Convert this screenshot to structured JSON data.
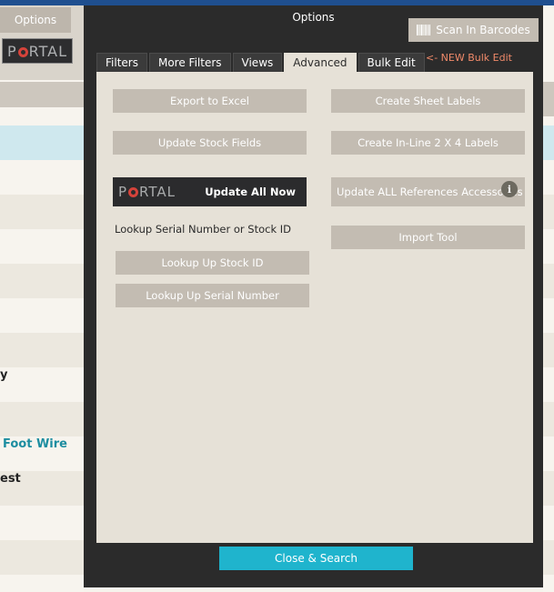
{
  "background": {
    "options_button": "Options",
    "portal_logo": {
      "before": "P",
      "after": "RTAL"
    },
    "row_snippets": [
      "y",
      "Foot Wire",
      "est"
    ]
  },
  "modal": {
    "title": "Options",
    "scan_button": "Scan In Barcodes",
    "tabs": [
      {
        "label": "Filters"
      },
      {
        "label": "More Filters"
      },
      {
        "label": "Views"
      },
      {
        "label": "Advanced",
        "active": true
      },
      {
        "label": "Bulk Edit"
      }
    ],
    "new_notice": "<- NEW Bulk Edit",
    "buttons": {
      "export_excel": "Export to Excel",
      "create_sheet_labels": "Create Sheet Labels",
      "update_stock_fields": "Update Stock Fields",
      "create_inline_labels": "Create In-Line 2 X 4 Labels",
      "update_all_now": "Update All Now",
      "update_all_references": "Update ALL References Accessories",
      "import_tool": "Import Tool",
      "lookup_stock_id": "Lookup Up Stock ID",
      "lookup_serial": "Lookup Up Serial Number"
    },
    "portal_logo": {
      "before": "P",
      "after": "RTAL"
    },
    "lookup_label": "Lookup Serial Number or Stock ID",
    "close_button": "Close & Search"
  },
  "colors": {
    "accent": "#1fb4cd",
    "button_gray": "#c3bcb2",
    "panel": "#e6e1d7",
    "modal_bg": "#2b2b2b",
    "notice": "#f08a6a",
    "portal_red": "#d5433b"
  }
}
